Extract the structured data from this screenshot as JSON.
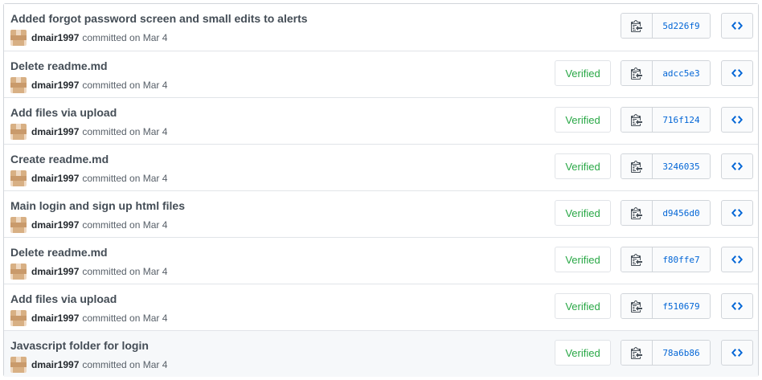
{
  "verified_label": "Verified",
  "commits": [
    {
      "message": "Added forgot password screen and small edits to alerts",
      "author": "dmair1997",
      "date_text": "committed on Mar 4",
      "verified": false,
      "sha": "5d226f9"
    },
    {
      "message": "Delete readme.md",
      "author": "dmair1997",
      "date_text": "committed on Mar 4",
      "verified": true,
      "sha": "adcc5e3"
    },
    {
      "message": "Add files via upload",
      "author": "dmair1997",
      "date_text": "committed on Mar 4",
      "verified": true,
      "sha": "716f124"
    },
    {
      "message": "Create readme.md",
      "author": "dmair1997",
      "date_text": "committed on Mar 4",
      "verified": true,
      "sha": "3246035"
    },
    {
      "message": "Main login and sign up html files",
      "author": "dmair1997",
      "date_text": "committed on Mar 4",
      "verified": true,
      "sha": "d9456d0"
    },
    {
      "message": "Delete readme.md",
      "author": "dmair1997",
      "date_text": "committed on Mar 4",
      "verified": true,
      "sha": "f80ffe7"
    },
    {
      "message": "Add files via upload",
      "author": "dmair1997",
      "date_text": "committed on Mar 4",
      "verified": true,
      "sha": "f510679"
    },
    {
      "message": "Javascript folder for login",
      "author": "dmair1997",
      "date_text": "committed on Mar 4",
      "verified": true,
      "sha": "78a6b86"
    }
  ],
  "colors": {
    "link_blue": "#0366d6",
    "verified_green": "#28a745",
    "highlight_row": "#f6f8fa"
  },
  "icons": {
    "copy": "clippy-icon",
    "browse": "code-icon"
  },
  "highlighted_row_index": 7
}
